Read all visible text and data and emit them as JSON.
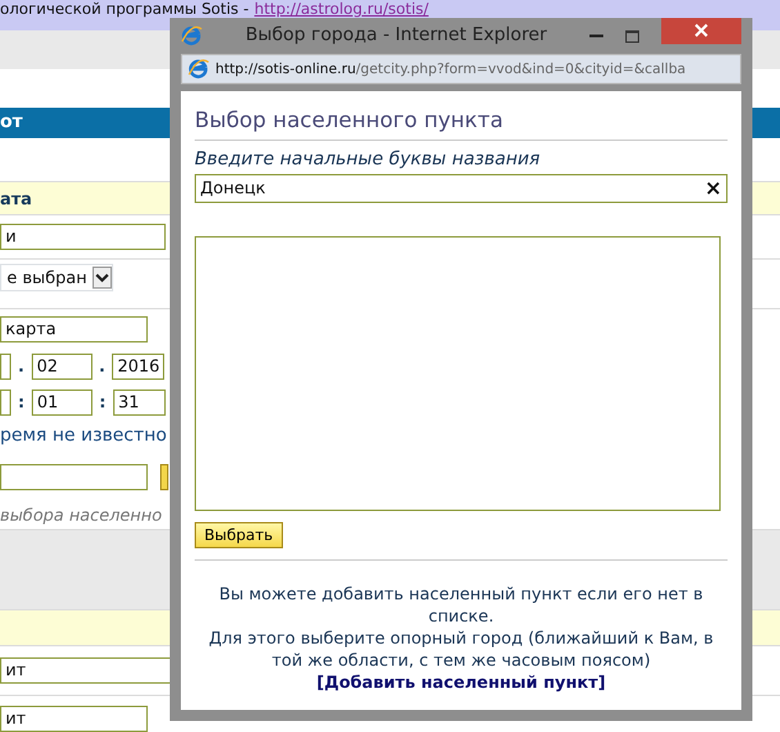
{
  "background_page": {
    "banner": {
      "text": "ологической программы Sotis - ",
      "link": "http://astrolog.ru/sotis/"
    },
    "header": "от",
    "section_title": "ата",
    "name_field": {
      "value": "и"
    },
    "select": {
      "value": "е выбран"
    },
    "map_field": {
      "value": "карта"
    },
    "date_fields": [
      {
        "value": "02"
      },
      {
        "value": "2016"
      }
    ],
    "date_separators": [
      ".",
      "."
    ],
    "time_fields": [
      {
        "value": "01"
      },
      {
        "value": "31"
      }
    ],
    "time_separators": [
      ":",
      ":"
    ],
    "time_unknown_label": "ремя не известно",
    "city_hint": "выбора населенно",
    "bottom_fields": [
      {
        "value": "ит"
      },
      {
        "value": "ит"
      }
    ]
  },
  "popup": {
    "title": "Выбор города - Internet Explorer",
    "address": {
      "host": "http://sotis-online.ru",
      "path": "/getcity.php?form=vvod&ind=0&cityid=&callba"
    },
    "heading": "Выбор населенного пункта",
    "prompt": "Введите начальные буквы названия",
    "search": {
      "value": "Донецк",
      "clear": "×"
    },
    "select_button": "Выбрать",
    "info": [
      "Вы можете добавить населенный пункт если его нет в списке.",
      "Для этого выберите опорный город (ближайший к Вам, в той же области, с тем же часовым поясом)"
    ],
    "add_link": {
      "open": "[",
      "text": "Добавить населенный пункт",
      "close": "]"
    }
  }
}
